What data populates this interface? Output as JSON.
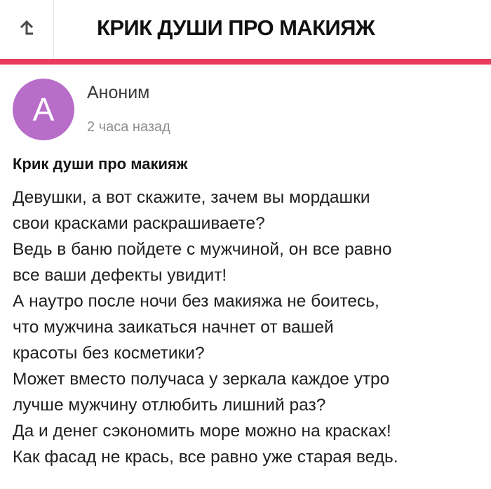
{
  "header": {
    "title": "КРИК ДУШИ ПРО МАКИЯЖ",
    "back_icon": "back-arrow-icon",
    "accent_color": "#ea3c5a"
  },
  "post": {
    "author": {
      "initial": "А",
      "name": "Аноним",
      "avatar_color": "#b86ec9"
    },
    "time": "2 часа назад",
    "title": "Крик души про макияж",
    "body_lines": [
      "Девушки, а вот скажите, зачем вы мордашки",
      "свои красками раскрашиваете?",
      "Ведь в баню пойдете с мужчиной, он все равно",
      "все ваши дефекты увидит!",
      "А наутро после ночи без макияжа не боитесь,",
      "что мужчина заикаться начнет от вашей",
      "красоты без косметики?",
      "Может вместо получаса у зеркала каждое утро",
      "лучше мужчину отлюбить лишний раз?",
      "Да и денег сэкономить море можно на красках!",
      "Как фасад не крась, все равно уже старая ведь."
    ]
  }
}
